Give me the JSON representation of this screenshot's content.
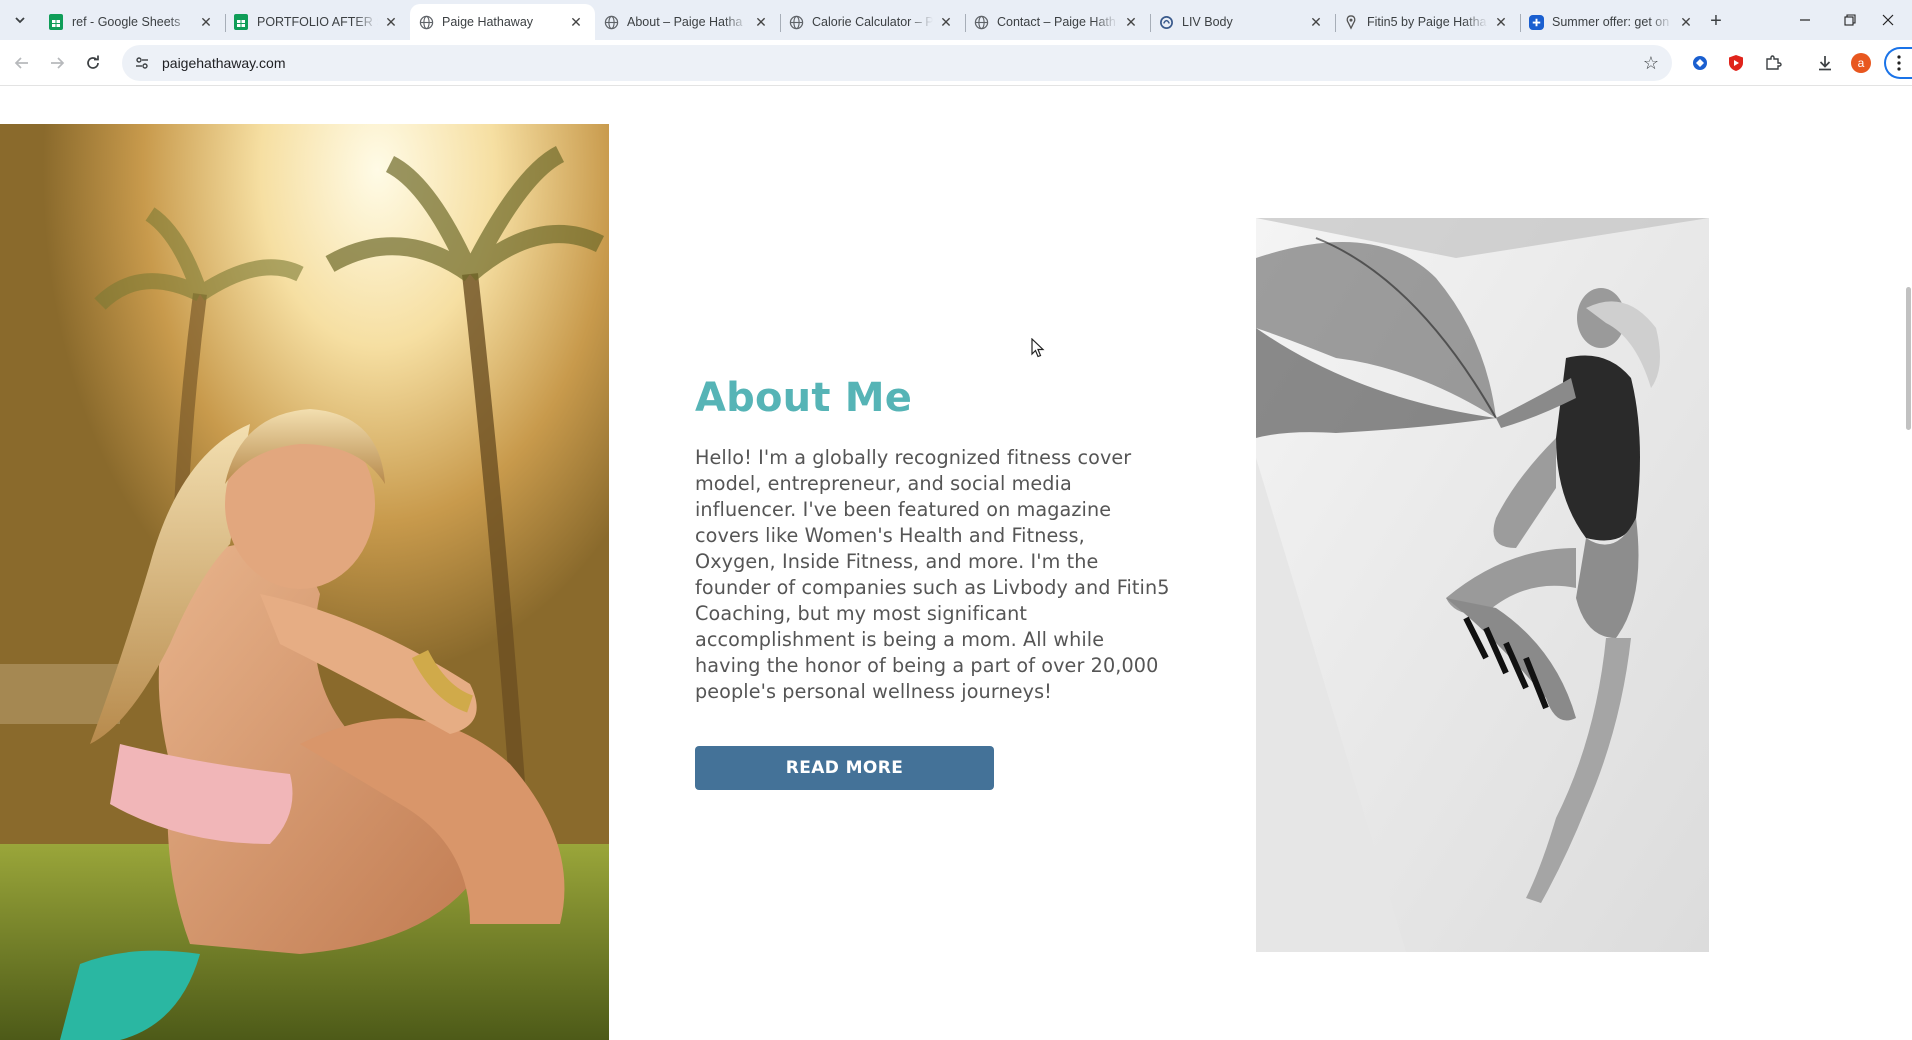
{
  "browser": {
    "tabs": [
      {
        "title": "ref - Google Sheets",
        "icon": "google-sheets-icon",
        "active": false
      },
      {
        "title": "PORTFOLIO AFTER SE",
        "icon": "google-sheets-icon",
        "active": false
      },
      {
        "title": "Paige Hathaway",
        "icon": "globe-icon",
        "active": true
      },
      {
        "title": "About – Paige Hatha",
        "icon": "globe-icon",
        "active": false
      },
      {
        "title": "Calorie Calculator – P",
        "icon": "globe-icon",
        "active": false
      },
      {
        "title": "Contact – Paige Hath",
        "icon": "globe-icon",
        "active": false
      },
      {
        "title": "LIV Body",
        "icon": "livbody-icon",
        "active": false
      },
      {
        "title": "Fitin5 by Paige Hatha",
        "icon": "fitin5-icon",
        "active": false
      },
      {
        "title": "Summer offer: get on",
        "icon": "offer-icon",
        "active": false
      }
    ],
    "url": "paigehathaway.com",
    "profile_initial": "a",
    "colors": {
      "sheets_green": "#0f9d58",
      "accent_blue": "#1a73e8",
      "profile": "#e8571f",
      "shield_red": "#e0241b"
    }
  },
  "page": {
    "about": {
      "title": "About Me",
      "body": "Hello! I'm a globally recognized fitness cover model, entrepreneur, and social media influencer. I've been featured on magazine covers like Women's Health and Fitness, Oxygen, Inside Fitness, and more. I'm the founder of companies such as Livbody and Fitin5 Coaching, but my most significant accomplishment is being a mom. All while having the honor of being a part of over 20,000 people's personal wellness journeys!",
      "button_label": "READ MORE"
    },
    "colors": {
      "title": "#56b4b6",
      "body_text": "#555555",
      "button": "#447298"
    }
  }
}
